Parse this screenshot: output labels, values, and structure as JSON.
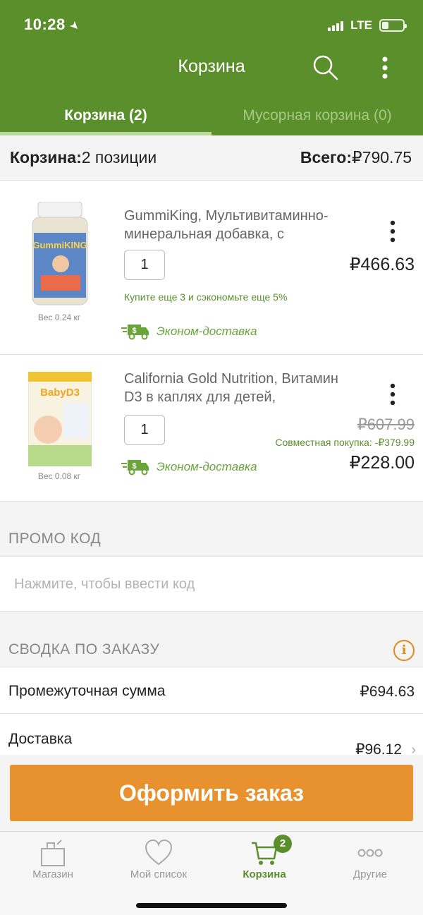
{
  "status": {
    "time": "10:28",
    "network": "LTE"
  },
  "header": {
    "title": "Корзина"
  },
  "tabs": [
    {
      "label": "Корзина (2)"
    },
    {
      "label": "Мусорная корзина (0)"
    }
  ],
  "cart_summary": {
    "count_label": "Корзина:",
    "count_value": "2 позиции",
    "total_label": "Всего:",
    "total_value": "₽790.75"
  },
  "items": [
    {
      "name": "GummiKing, Мультивитаминно-минеральная добавка, с",
      "weight": "Вес 0.24 кг",
      "quantity": "1",
      "price": "₽466.63",
      "promo": "Купите еще 3 и сэкономьте еще 5%",
      "shipping": "Эконом-доставка",
      "image_label": "GummiKING"
    },
    {
      "name": "California Gold Nutrition, Витамин D3 в каплях для детей,",
      "weight": "Вес 0.08 кг",
      "quantity": "1",
      "old_price": "₽607.99",
      "bundle": "Совместная покупка: -₽379.99",
      "price": "₽228.00",
      "shipping": "Эконом-доставка",
      "image_label": "BabyD3"
    }
  ],
  "promo": {
    "title": "ПРОМО КОД",
    "placeholder": "Нажмите, чтобы ввести код"
  },
  "order_summary": {
    "title": "СВОДКА ПО ЗАКАЗУ",
    "subtotal_label": "Промежуточная сумма",
    "subtotal_value": "₽694.63",
    "shipping_label": "Доставка",
    "shipping_value": "₽96.12"
  },
  "checkout": {
    "label": "Оформить заказ"
  },
  "tabbar": [
    {
      "label": "Магазин",
      "icon": "shop-icon"
    },
    {
      "label": "Мой список",
      "icon": "heart-icon"
    },
    {
      "label": "Корзина",
      "icon": "cart-icon",
      "badge": "2"
    },
    {
      "label": "Другие",
      "icon": "more-icon"
    }
  ],
  "colors": {
    "brand_green": "#5a8f2c",
    "checkout_orange": "#e8922f"
  }
}
